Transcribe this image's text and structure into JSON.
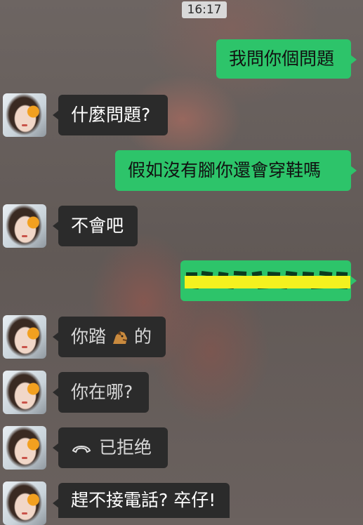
{
  "status": {
    "time": "16:17"
  },
  "messages": [
    {
      "side": "right",
      "text": "我問你個問題"
    },
    {
      "side": "left",
      "text": "什麼問題?"
    },
    {
      "side": "right",
      "text": "假如沒有腳你還會穿鞋嗎"
    },
    {
      "side": "left",
      "text": "不會吧"
    },
    {
      "side": "right",
      "text": "",
      "redacted": true
    },
    {
      "side": "left",
      "text_before": "你踏",
      "icon": "horse-emoji",
      "text_after": "的"
    },
    {
      "side": "left",
      "text": "你在哪?"
    },
    {
      "side": "left",
      "icon": "declined-call-icon",
      "text": "已拒绝"
    },
    {
      "side": "left",
      "text": "趕不接電話? 卒仔!"
    }
  ],
  "colors": {
    "outgoing_bubble": "#2dc46a",
    "incoming_bubble": "#2b2b2b",
    "redaction": "#f4f11f"
  }
}
